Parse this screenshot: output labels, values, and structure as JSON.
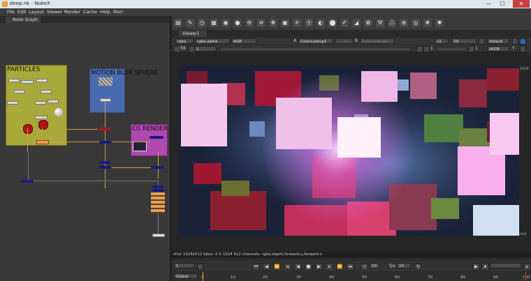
{
  "window": {
    "title": "deep.nk - NukeX",
    "minimize": "—",
    "maximize": "☐",
    "close": "✕"
  },
  "menu": [
    "File",
    "Edit",
    "Layout",
    "Viewer",
    "Render",
    "Cache",
    "Help",
    "Mari"
  ],
  "node_graph": {
    "tab": "Node Graph",
    "backdrops": {
      "particles": "PARTICLES",
      "motion_blur": "MOTION BLUR SPHERE",
      "cg_render": "CG RENDER"
    }
  },
  "viewer": {
    "tab": "Viewer1",
    "channels": "rgba",
    "alpha_channel": "rgba.alpha",
    "display_channels": "RGB",
    "a_label": "A",
    "a_input": "ColorLookup1",
    "a_op": "-",
    "b_label": "B",
    "b_input": "ColorLookup1",
    "zoom": "x1",
    "view_mode": "2D",
    "lut": "default",
    "fstop_label": "f/8",
    "frame_field": "1",
    "gamma_field": "1",
    "proxy_field": "1",
    "colorspace": "sRGB",
    "y_label": "Y",
    "corner_label": "1024",
    "side_label": "shot",
    "info": "shot 1024x512  bbox: 0 0 1024 512  channels: rgba,depth,forward.u,forward.v"
  },
  "playback": {
    "frame": "1",
    "increment": "10",
    "fps_label": "fps",
    "fps": "24",
    "range_mode": "Global",
    "timeline_ticks": [
      "1",
      "10",
      "20",
      "30",
      "40",
      "50",
      "60",
      "70",
      "80",
      "90",
      "100"
    ]
  }
}
